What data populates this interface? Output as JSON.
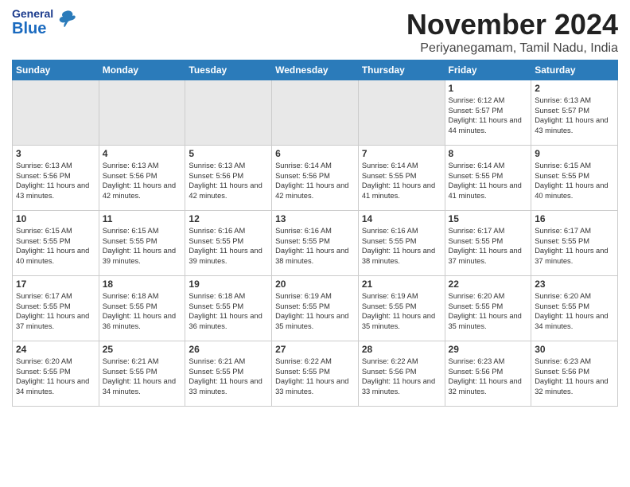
{
  "header": {
    "logo": {
      "general": "General",
      "blue": "Blue",
      "tagline": "GeneralBlue"
    },
    "title": "November 2024",
    "location": "Periyanegamam, Tamil Nadu, India"
  },
  "weekdays": [
    "Sunday",
    "Monday",
    "Tuesday",
    "Wednesday",
    "Thursday",
    "Friday",
    "Saturday"
  ],
  "weeks": [
    [
      {
        "day": "",
        "empty": true
      },
      {
        "day": "",
        "empty": true
      },
      {
        "day": "",
        "empty": true
      },
      {
        "day": "",
        "empty": true
      },
      {
        "day": "",
        "empty": true
      },
      {
        "day": "1",
        "sunrise": "Sunrise: 6:12 AM",
        "sunset": "Sunset: 5:57 PM",
        "daylight": "Daylight: 11 hours and 44 minutes."
      },
      {
        "day": "2",
        "sunrise": "Sunrise: 6:13 AM",
        "sunset": "Sunset: 5:57 PM",
        "daylight": "Daylight: 11 hours and 43 minutes."
      }
    ],
    [
      {
        "day": "3",
        "sunrise": "Sunrise: 6:13 AM",
        "sunset": "Sunset: 5:56 PM",
        "daylight": "Daylight: 11 hours and 43 minutes."
      },
      {
        "day": "4",
        "sunrise": "Sunrise: 6:13 AM",
        "sunset": "Sunset: 5:56 PM",
        "daylight": "Daylight: 11 hours and 42 minutes."
      },
      {
        "day": "5",
        "sunrise": "Sunrise: 6:13 AM",
        "sunset": "Sunset: 5:56 PM",
        "daylight": "Daylight: 11 hours and 42 minutes."
      },
      {
        "day": "6",
        "sunrise": "Sunrise: 6:14 AM",
        "sunset": "Sunset: 5:56 PM",
        "daylight": "Daylight: 11 hours and 42 minutes."
      },
      {
        "day": "7",
        "sunrise": "Sunrise: 6:14 AM",
        "sunset": "Sunset: 5:55 PM",
        "daylight": "Daylight: 11 hours and 41 minutes."
      },
      {
        "day": "8",
        "sunrise": "Sunrise: 6:14 AM",
        "sunset": "Sunset: 5:55 PM",
        "daylight": "Daylight: 11 hours and 41 minutes."
      },
      {
        "day": "9",
        "sunrise": "Sunrise: 6:15 AM",
        "sunset": "Sunset: 5:55 PM",
        "daylight": "Daylight: 11 hours and 40 minutes."
      }
    ],
    [
      {
        "day": "10",
        "sunrise": "Sunrise: 6:15 AM",
        "sunset": "Sunset: 5:55 PM",
        "daylight": "Daylight: 11 hours and 40 minutes."
      },
      {
        "day": "11",
        "sunrise": "Sunrise: 6:15 AM",
        "sunset": "Sunset: 5:55 PM",
        "daylight": "Daylight: 11 hours and 39 minutes."
      },
      {
        "day": "12",
        "sunrise": "Sunrise: 6:16 AM",
        "sunset": "Sunset: 5:55 PM",
        "daylight": "Daylight: 11 hours and 39 minutes."
      },
      {
        "day": "13",
        "sunrise": "Sunrise: 6:16 AM",
        "sunset": "Sunset: 5:55 PM",
        "daylight": "Daylight: 11 hours and 38 minutes."
      },
      {
        "day": "14",
        "sunrise": "Sunrise: 6:16 AM",
        "sunset": "Sunset: 5:55 PM",
        "daylight": "Daylight: 11 hours and 38 minutes."
      },
      {
        "day": "15",
        "sunrise": "Sunrise: 6:17 AM",
        "sunset": "Sunset: 5:55 PM",
        "daylight": "Daylight: 11 hours and 37 minutes."
      },
      {
        "day": "16",
        "sunrise": "Sunrise: 6:17 AM",
        "sunset": "Sunset: 5:55 PM",
        "daylight": "Daylight: 11 hours and 37 minutes."
      }
    ],
    [
      {
        "day": "17",
        "sunrise": "Sunrise: 6:17 AM",
        "sunset": "Sunset: 5:55 PM",
        "daylight": "Daylight: 11 hours and 37 minutes."
      },
      {
        "day": "18",
        "sunrise": "Sunrise: 6:18 AM",
        "sunset": "Sunset: 5:55 PM",
        "daylight": "Daylight: 11 hours and 36 minutes."
      },
      {
        "day": "19",
        "sunrise": "Sunrise: 6:18 AM",
        "sunset": "Sunset: 5:55 PM",
        "daylight": "Daylight: 11 hours and 36 minutes."
      },
      {
        "day": "20",
        "sunrise": "Sunrise: 6:19 AM",
        "sunset": "Sunset: 5:55 PM",
        "daylight": "Daylight: 11 hours and 35 minutes."
      },
      {
        "day": "21",
        "sunrise": "Sunrise: 6:19 AM",
        "sunset": "Sunset: 5:55 PM",
        "daylight": "Daylight: 11 hours and 35 minutes."
      },
      {
        "day": "22",
        "sunrise": "Sunrise: 6:20 AM",
        "sunset": "Sunset: 5:55 PM",
        "daylight": "Daylight: 11 hours and 35 minutes."
      },
      {
        "day": "23",
        "sunrise": "Sunrise: 6:20 AM",
        "sunset": "Sunset: 5:55 PM",
        "daylight": "Daylight: 11 hours and 34 minutes."
      }
    ],
    [
      {
        "day": "24",
        "sunrise": "Sunrise: 6:20 AM",
        "sunset": "Sunset: 5:55 PM",
        "daylight": "Daylight: 11 hours and 34 minutes."
      },
      {
        "day": "25",
        "sunrise": "Sunrise: 6:21 AM",
        "sunset": "Sunset: 5:55 PM",
        "daylight": "Daylight: 11 hours and 34 minutes."
      },
      {
        "day": "26",
        "sunrise": "Sunrise: 6:21 AM",
        "sunset": "Sunset: 5:55 PM",
        "daylight": "Daylight: 11 hours and 33 minutes."
      },
      {
        "day": "27",
        "sunrise": "Sunrise: 6:22 AM",
        "sunset": "Sunset: 5:55 PM",
        "daylight": "Daylight: 11 hours and 33 minutes."
      },
      {
        "day": "28",
        "sunrise": "Sunrise: 6:22 AM",
        "sunset": "Sunset: 5:56 PM",
        "daylight": "Daylight: 11 hours and 33 minutes."
      },
      {
        "day": "29",
        "sunrise": "Sunrise: 6:23 AM",
        "sunset": "Sunset: 5:56 PM",
        "daylight": "Daylight: 11 hours and 32 minutes."
      },
      {
        "day": "30",
        "sunrise": "Sunrise: 6:23 AM",
        "sunset": "Sunset: 5:56 PM",
        "daylight": "Daylight: 11 hours and 32 minutes."
      }
    ]
  ]
}
